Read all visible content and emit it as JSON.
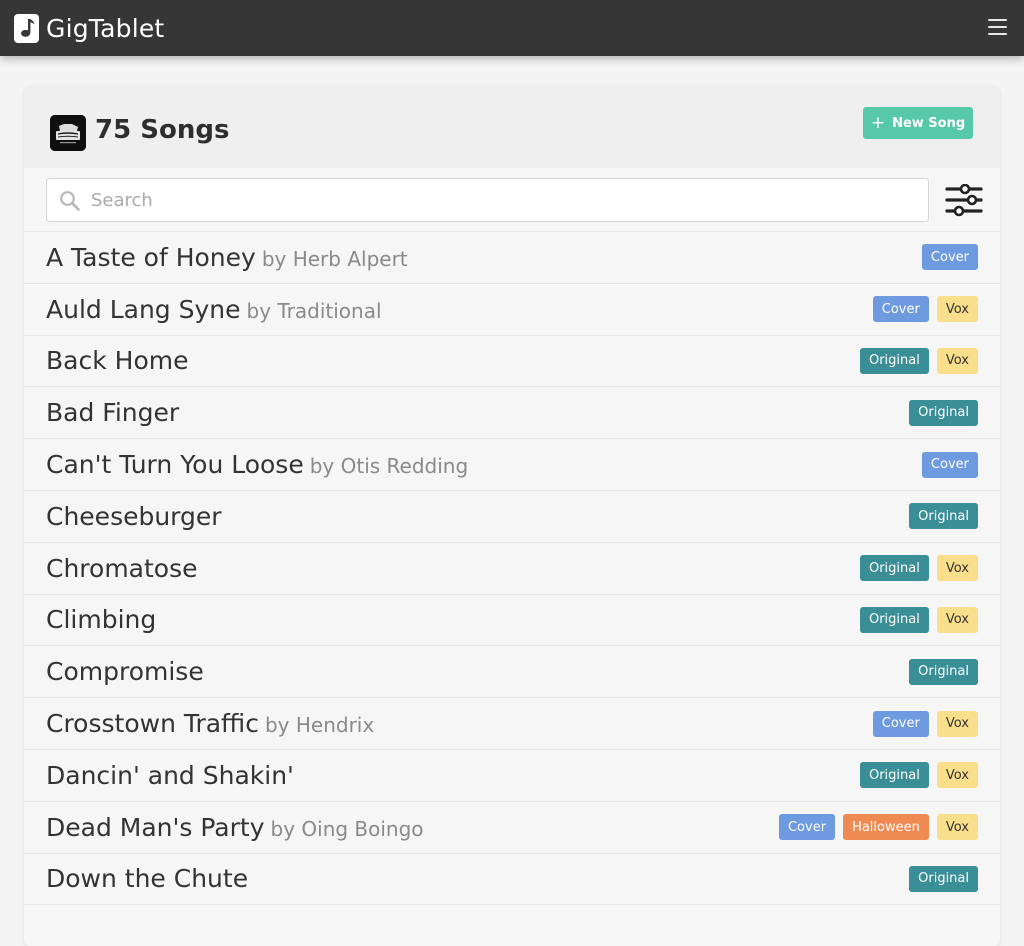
{
  "app": {
    "name": "GigTablet",
    "logo_icon": "music-note-icon",
    "menu_icon": "hamburger-menu-icon"
  },
  "header": {
    "title": "75 Songs",
    "avatar": "band-logo",
    "new_song_label": "New Song",
    "new_song_icon": "plus-icon"
  },
  "search": {
    "placeholder": "Search",
    "value": "",
    "icon": "search-icon",
    "filter_icon": "sliders-icon"
  },
  "colors": {
    "topbar": "#363636",
    "accent": "#57c9a8",
    "tag_cover": "#6e9ae0",
    "tag_original": "#3a8f97",
    "tag_vox": "#f9df8c",
    "tag_halloween": "#ee8a52"
  },
  "songs": [
    {
      "title": "A Taste of Honey",
      "artist": "by Herb Alpert",
      "tags": [
        "Cover"
      ]
    },
    {
      "title": "Auld Lang Syne",
      "artist": "by Traditional",
      "tags": [
        "Cover",
        "Vox"
      ]
    },
    {
      "title": "Back Home",
      "artist": "",
      "tags": [
        "Original",
        "Vox"
      ]
    },
    {
      "title": "Bad Finger",
      "artist": "",
      "tags": [
        "Original"
      ]
    },
    {
      "title": "Can't Turn You Loose",
      "artist": "by Otis Redding",
      "tags": [
        "Cover"
      ]
    },
    {
      "title": "Cheeseburger",
      "artist": "",
      "tags": [
        "Original"
      ]
    },
    {
      "title": "Chromatose",
      "artist": "",
      "tags": [
        "Original",
        "Vox"
      ]
    },
    {
      "title": "Climbing",
      "artist": "",
      "tags": [
        "Original",
        "Vox"
      ]
    },
    {
      "title": "Compromise",
      "artist": "",
      "tags": [
        "Original"
      ]
    },
    {
      "title": "Crosstown Traffic",
      "artist": "by Hendrix",
      "tags": [
        "Cover",
        "Vox"
      ]
    },
    {
      "title": "Dancin' and Shakin'",
      "artist": "",
      "tags": [
        "Original",
        "Vox"
      ]
    },
    {
      "title": "Dead Man's Party",
      "artist": "by Oing Boingo",
      "tags": [
        "Cover",
        "Halloween",
        "Vox"
      ]
    },
    {
      "title": "Down the Chute",
      "artist": "",
      "tags": [
        "Original"
      ]
    }
  ]
}
